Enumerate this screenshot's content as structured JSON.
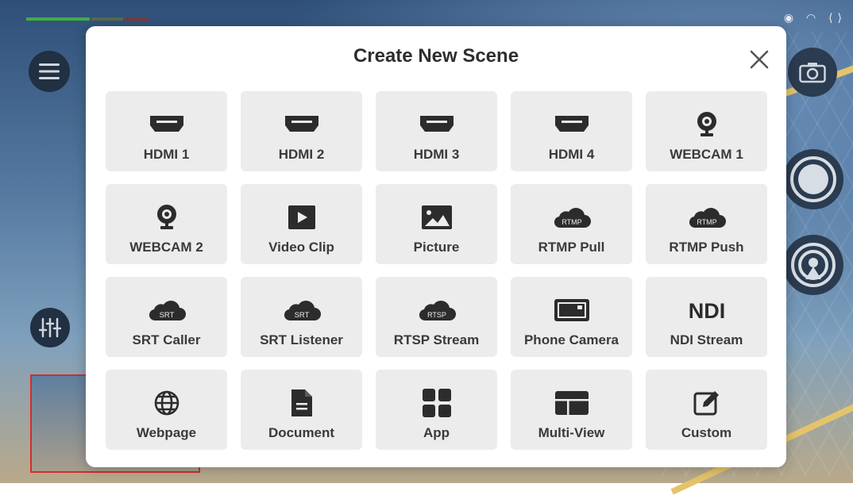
{
  "modal": {
    "title": "Create New Scene",
    "close_icon": "close-icon"
  },
  "scenes": [
    {
      "label": "HDMI 1",
      "icon": "hdmi-icon"
    },
    {
      "label": "HDMI 2",
      "icon": "hdmi-icon"
    },
    {
      "label": "HDMI 3",
      "icon": "hdmi-icon"
    },
    {
      "label": "HDMI 4",
      "icon": "hdmi-icon"
    },
    {
      "label": "WEBCAM 1",
      "icon": "webcam-icon"
    },
    {
      "label": "WEBCAM 2",
      "icon": "webcam-icon"
    },
    {
      "label": "Video Clip",
      "icon": "play-icon"
    },
    {
      "label": "Picture",
      "icon": "picture-icon"
    },
    {
      "label": "RTMP Pull",
      "icon": "cloud-icon",
      "badge": "RTMP"
    },
    {
      "label": "RTMP Push",
      "icon": "cloud-icon",
      "badge": "RTMP"
    },
    {
      "label": "SRT Caller",
      "icon": "cloud-icon",
      "badge": "SRT"
    },
    {
      "label": "SRT Listener",
      "icon": "cloud-icon",
      "badge": "SRT"
    },
    {
      "label": "RTSP Stream",
      "icon": "cloud-icon",
      "badge": "RTSP"
    },
    {
      "label": "Phone Camera",
      "icon": "phone-camera-icon"
    },
    {
      "label": "NDI Stream",
      "icon": "ndi-icon",
      "badge": "NDI"
    },
    {
      "label": "Webpage",
      "icon": "globe-icon"
    },
    {
      "label": "Document",
      "icon": "document-icon"
    },
    {
      "label": "App",
      "icon": "app-grid-icon"
    },
    {
      "label": "Multi-View",
      "icon": "multi-view-icon"
    },
    {
      "label": "Custom",
      "icon": "edit-icon"
    }
  ],
  "colors": {
    "icon": "#2c2c2c",
    "tile_bg": "#ececec",
    "record_accent": "#d12d2d"
  }
}
